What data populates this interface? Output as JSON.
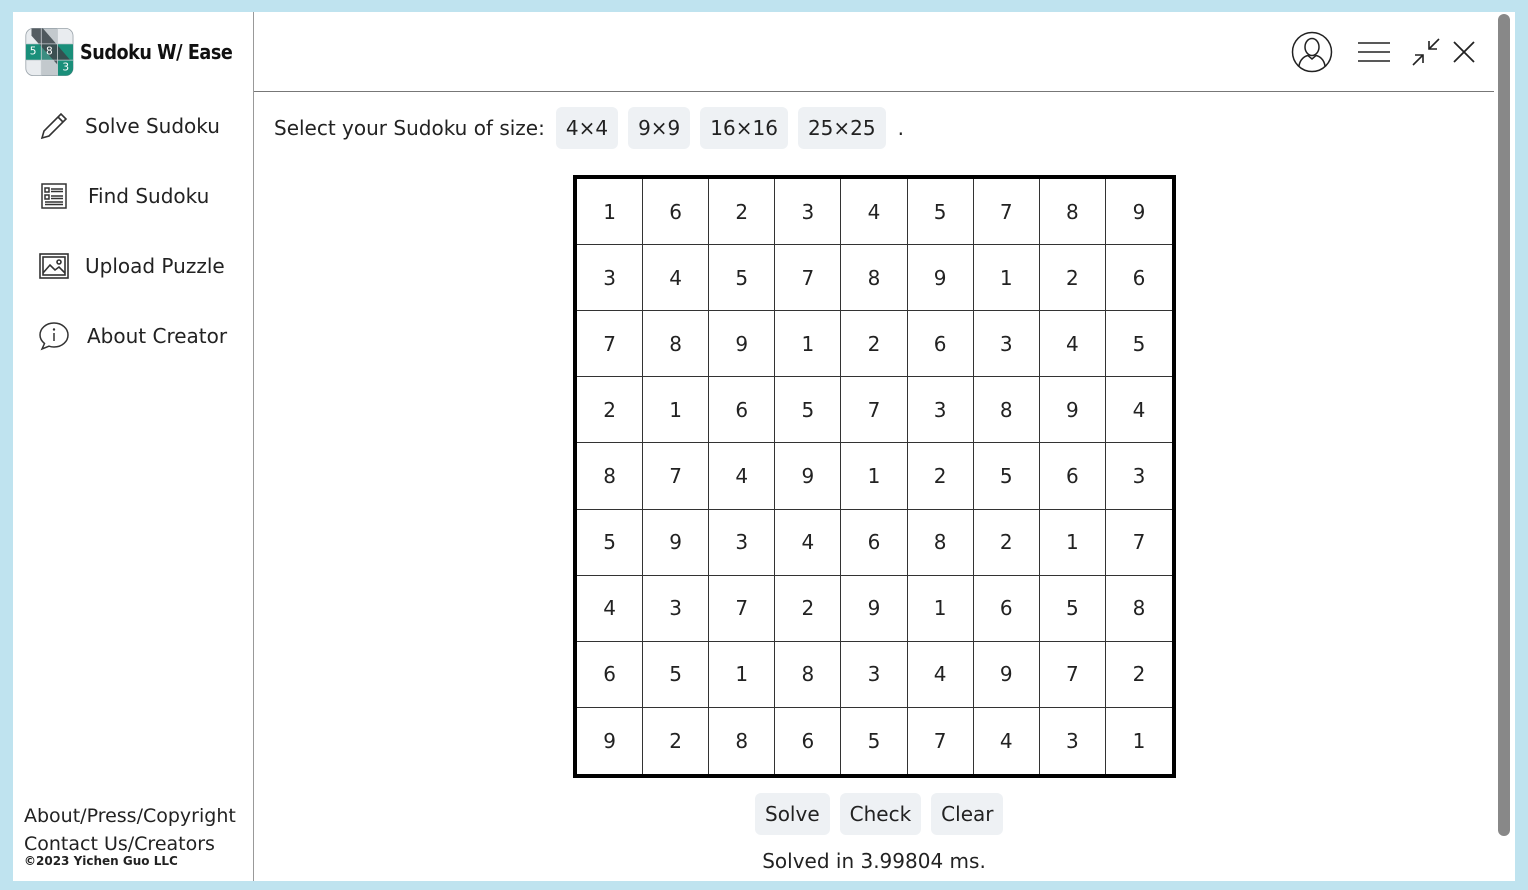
{
  "app": {
    "brand_name": "Sudoku W/ Ease",
    "logo_digits": [
      "5",
      "8",
      "3"
    ]
  },
  "sidebar": {
    "items": [
      {
        "label": "Solve Sudoku",
        "icon": "pencil-icon"
      },
      {
        "label": "Find Sudoku",
        "icon": "list-icon"
      },
      {
        "label": "Upload Puzzle",
        "icon": "image-icon"
      },
      {
        "label": "About Creator",
        "icon": "info-icon"
      }
    ],
    "footer": {
      "about_link": "About/Press/Copyright",
      "contact_link": "Contact Us/Creators",
      "copyright": "©2023 Yichen Guo LLC"
    }
  },
  "header": {
    "icons": [
      "user-icon",
      "menu-icon",
      "minimize-icon",
      "close-icon"
    ]
  },
  "size_selector": {
    "prompt": "Select your Sudoku of size:",
    "options": [
      "4×4",
      "9×9",
      "16×16",
      "25×25"
    ],
    "trailing": "."
  },
  "board": {
    "size": 9,
    "rows": [
      [
        "1",
        "6",
        "2",
        "3",
        "4",
        "5",
        "7",
        "8",
        "9"
      ],
      [
        "3",
        "4",
        "5",
        "7",
        "8",
        "9",
        "1",
        "2",
        "6"
      ],
      [
        "7",
        "8",
        "9",
        "1",
        "2",
        "6",
        "3",
        "4",
        "5"
      ],
      [
        "2",
        "1",
        "6",
        "5",
        "7",
        "3",
        "8",
        "9",
        "4"
      ],
      [
        "8",
        "7",
        "4",
        "9",
        "1",
        "2",
        "5",
        "6",
        "3"
      ],
      [
        "5",
        "9",
        "3",
        "4",
        "6",
        "8",
        "2",
        "1",
        "7"
      ],
      [
        "4",
        "3",
        "7",
        "2",
        "9",
        "1",
        "6",
        "5",
        "8"
      ],
      [
        "6",
        "5",
        "1",
        "8",
        "3",
        "4",
        "9",
        "7",
        "2"
      ],
      [
        "9",
        "2",
        "8",
        "6",
        "5",
        "7",
        "4",
        "3",
        "1"
      ]
    ]
  },
  "actions": {
    "solve": "Solve",
    "check": "Check",
    "clear": "Clear"
  },
  "status": "Solved in 3.99804 ms.",
  "colors": {
    "background": "#bfe3ef",
    "logo_teal": "#1a8f7a",
    "button_bg": "#eef1f4"
  }
}
